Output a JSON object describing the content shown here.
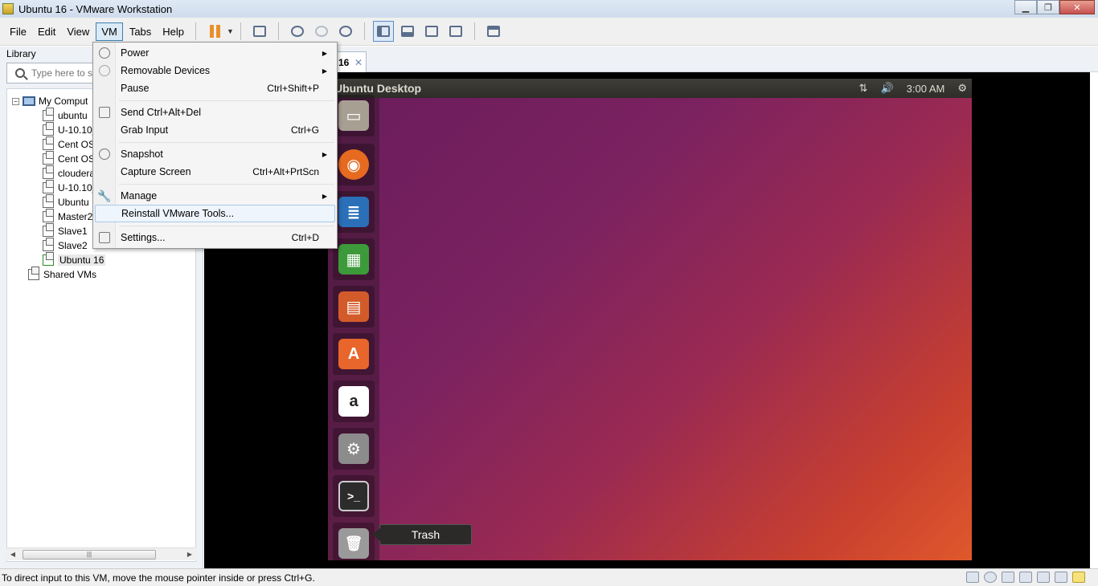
{
  "window": {
    "title": "Ubuntu 16 - VMware Workstation"
  },
  "menubar": {
    "file": "File",
    "edit": "Edit",
    "view": "View",
    "vm": "VM",
    "tabs": "Tabs",
    "help": "Help"
  },
  "library": {
    "title": "Library",
    "search_placeholder": "Type here to s",
    "tree": {
      "root": "My Comput",
      "items": [
        "ubuntu",
        "U-10.10_",
        "Cent OS",
        "Cent OS",
        "cloudera",
        "U-10.10_",
        "Ubuntu",
        "Master2",
        "Slave1",
        "Slave2",
        "Ubuntu 16"
      ],
      "shared": "Shared VMs"
    }
  },
  "tab": {
    "label": "16",
    "close": "✕"
  },
  "vm_menu": {
    "power": "Power",
    "removable": "Removable Devices",
    "pause": "Pause",
    "pause_shortcut": "Ctrl+Shift+P",
    "send_cad": "Send Ctrl+Alt+Del",
    "grab_input": "Grab Input",
    "grab_shortcut": "Ctrl+G",
    "snapshot": "Snapshot",
    "capture_screen": "Capture Screen",
    "capture_shortcut": "Ctrl+Alt+PrtScn",
    "manage": "Manage",
    "reinstall": "Reinstall VMware Tools...",
    "settings": "Settings...",
    "settings_shortcut": "Ctrl+D"
  },
  "ubuntu": {
    "panel_title": "Ubuntu Desktop",
    "clock": "3:00 AM",
    "tooltip": "Trash",
    "launcher": [
      {
        "name": "files",
        "glyph": "▭",
        "color": "#a89f93"
      },
      {
        "name": "firefox",
        "glyph": "◉",
        "color": "#e66a1f"
      },
      {
        "name": "writer",
        "glyph": "≣",
        "color": "#2a6fb8"
      },
      {
        "name": "calc",
        "glyph": "▦",
        "color": "#3d9a3a"
      },
      {
        "name": "impress",
        "glyph": "▤",
        "color": "#d35b2a"
      },
      {
        "name": "software",
        "glyph": "A",
        "color": "#e8662b"
      },
      {
        "name": "amazon",
        "glyph": "a",
        "color": "#222222"
      },
      {
        "name": "settings",
        "glyph": "⚙",
        "color": "#8c8c8c"
      },
      {
        "name": "terminal",
        "glyph": ">_",
        "color": "#2c2c2c"
      },
      {
        "name": "trash",
        "glyph": "🗑",
        "color": "#9a9a9a"
      }
    ]
  },
  "status": {
    "text": "To direct input to this VM, move the mouse pointer inside or press Ctrl+G."
  }
}
